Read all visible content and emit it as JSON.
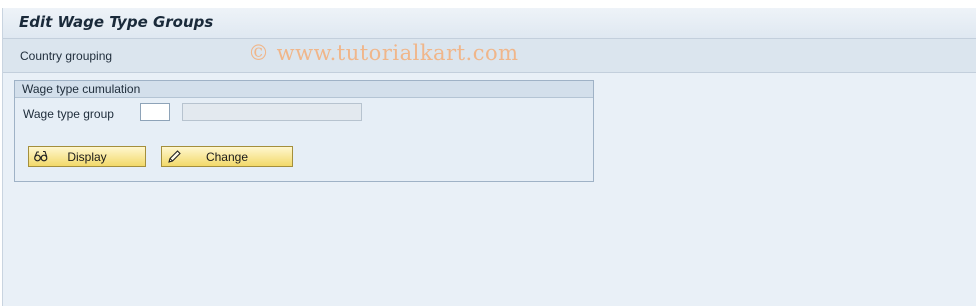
{
  "window": {
    "title": "Edit Wage Type Groups"
  },
  "toolbar": {
    "country_grouping_label": "Country grouping"
  },
  "watermark": "© www.tutorialkart.com",
  "groupbox": {
    "title": "Wage type cumulation",
    "wage_type_group": {
      "label": "Wage type group",
      "value": "",
      "description": ""
    }
  },
  "buttons": {
    "display": {
      "label": "Display",
      "icon": "glasses-icon"
    },
    "change": {
      "label": "Change",
      "icon": "pencil-icon"
    }
  }
}
